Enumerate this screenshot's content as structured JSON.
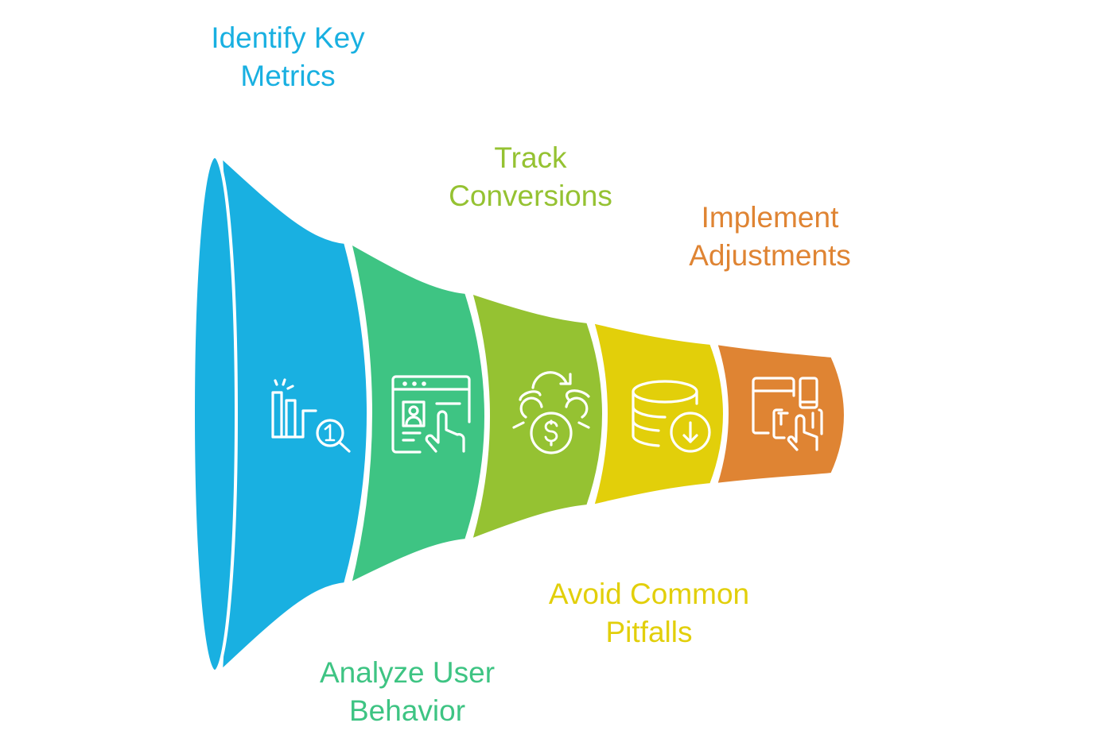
{
  "diagram": {
    "type": "funnel",
    "stages": [
      {
        "label_line1": "Identify Key",
        "label_line2": "Metrics",
        "color": "#19B0E1",
        "icon": "bar-chart-magnifier-icon",
        "label_position": "top"
      },
      {
        "label_line1": "Analyze User",
        "label_line2": "Behavior",
        "color": "#3EC483",
        "icon": "browser-profile-click-icon",
        "label_position": "bottom"
      },
      {
        "label_line1": "Track",
        "label_line2": "Conversions",
        "color": "#95C232",
        "icon": "coins-dollar-exchange-icon",
        "label_position": "top"
      },
      {
        "label_line1": "Avoid Common",
        "label_line2": "Pitfalls",
        "color": "#E2CF0A",
        "icon": "database-download-icon",
        "label_position": "bottom"
      },
      {
        "label_line1": "Implement",
        "label_line2": "Adjustments",
        "color": "#DF8433",
        "icon": "devices-touch-icon",
        "label_position": "top"
      }
    ],
    "separator_color": "#FFFFFF",
    "icon_color": "#FFFFFF"
  }
}
